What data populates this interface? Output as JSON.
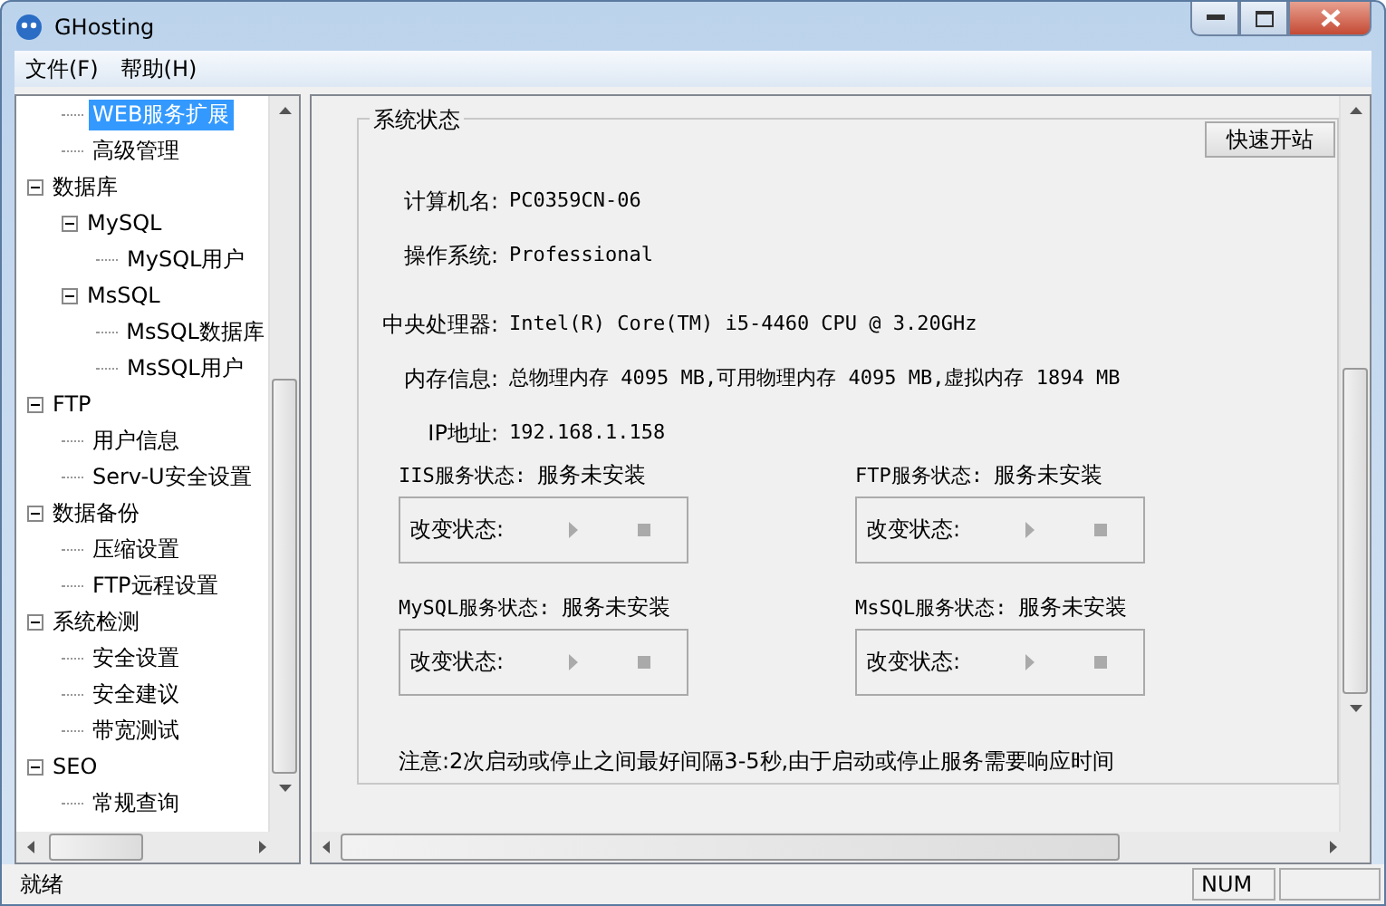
{
  "window": {
    "title": "GHosting"
  },
  "menu": [
    {
      "label": "文件(F)"
    },
    {
      "label": "帮助(H)"
    }
  ],
  "tree": {
    "scrolled_children": [
      {
        "label": "WEB服务扩展",
        "selected": true
      },
      {
        "label": "高级管理",
        "selected": false
      }
    ],
    "items": [
      {
        "label": "数据库",
        "selected": false,
        "expanded": true,
        "children": [
          {
            "label": "MySQL",
            "selected": false,
            "expanded": true,
            "children": [
              {
                "label": "MySQL用户",
                "selected": false
              }
            ]
          },
          {
            "label": "MsSQL",
            "selected": false,
            "expanded": true,
            "children": [
              {
                "label": "MsSQL数据库",
                "selected": false
              },
              {
                "label": "MsSQL用户",
                "selected": false
              }
            ]
          }
        ]
      },
      {
        "label": "FTP",
        "selected": false,
        "expanded": true,
        "children": [
          {
            "label": "用户信息",
            "selected": false
          },
          {
            "label": "Serv-U安全设置",
            "selected": false
          }
        ]
      },
      {
        "label": "数据备份",
        "selected": false,
        "expanded": true,
        "children": [
          {
            "label": "压缩设置",
            "selected": false
          },
          {
            "label": "FTP远程设置",
            "selected": false
          }
        ]
      },
      {
        "label": "系统检测",
        "selected": false,
        "expanded": true,
        "children": [
          {
            "label": "安全设置",
            "selected": false
          },
          {
            "label": "安全建议",
            "selected": false
          },
          {
            "label": "带宽测试",
            "selected": false
          }
        ]
      },
      {
        "label": "SEO",
        "selected": false,
        "expanded": true,
        "children": [
          {
            "label": "常规查询",
            "selected": false
          }
        ]
      }
    ]
  },
  "group": {
    "title": "系统状态",
    "button": "快速开站",
    "fields": [
      {
        "label": "计算机名:",
        "value": "PC0359CN-06"
      },
      {
        "label": "操作系统:",
        "value": "Professional"
      },
      {
        "label": "中央处理器:",
        "value": "Intel(R) Core(TM) i5-4460  CPU @ 3.20GHz"
      },
      {
        "label": "内存信息:",
        "value": "总物理内存 4095 MB,可用物理内存 4095 MB,虚拟内存 1894 MB"
      },
      {
        "label": "IP地址:",
        "value": "192.168.1.158"
      }
    ],
    "services": [
      {
        "label": "IIS服务状态:",
        "status": "服务未安装",
        "control_label": "改变状态:",
        "disabled": true
      },
      {
        "label": "FTP服务状态:",
        "status": "服务未安装",
        "control_label": "改变状态:",
        "disabled": true
      },
      {
        "label": "MySQL服务状态:",
        "status": "服务未安装",
        "control_label": "改变状态:",
        "disabled": true
      },
      {
        "label": "MsSQL服务状态:",
        "status": "服务未安装",
        "control_label": "改变状态:",
        "disabled": true
      }
    ],
    "note": "注意:2次启动或停止之间最好间隔3-5秒,由于启动或停止服务需要响应时间"
  },
  "status_bar": {
    "text": "就绪",
    "indicator": "NUM"
  }
}
